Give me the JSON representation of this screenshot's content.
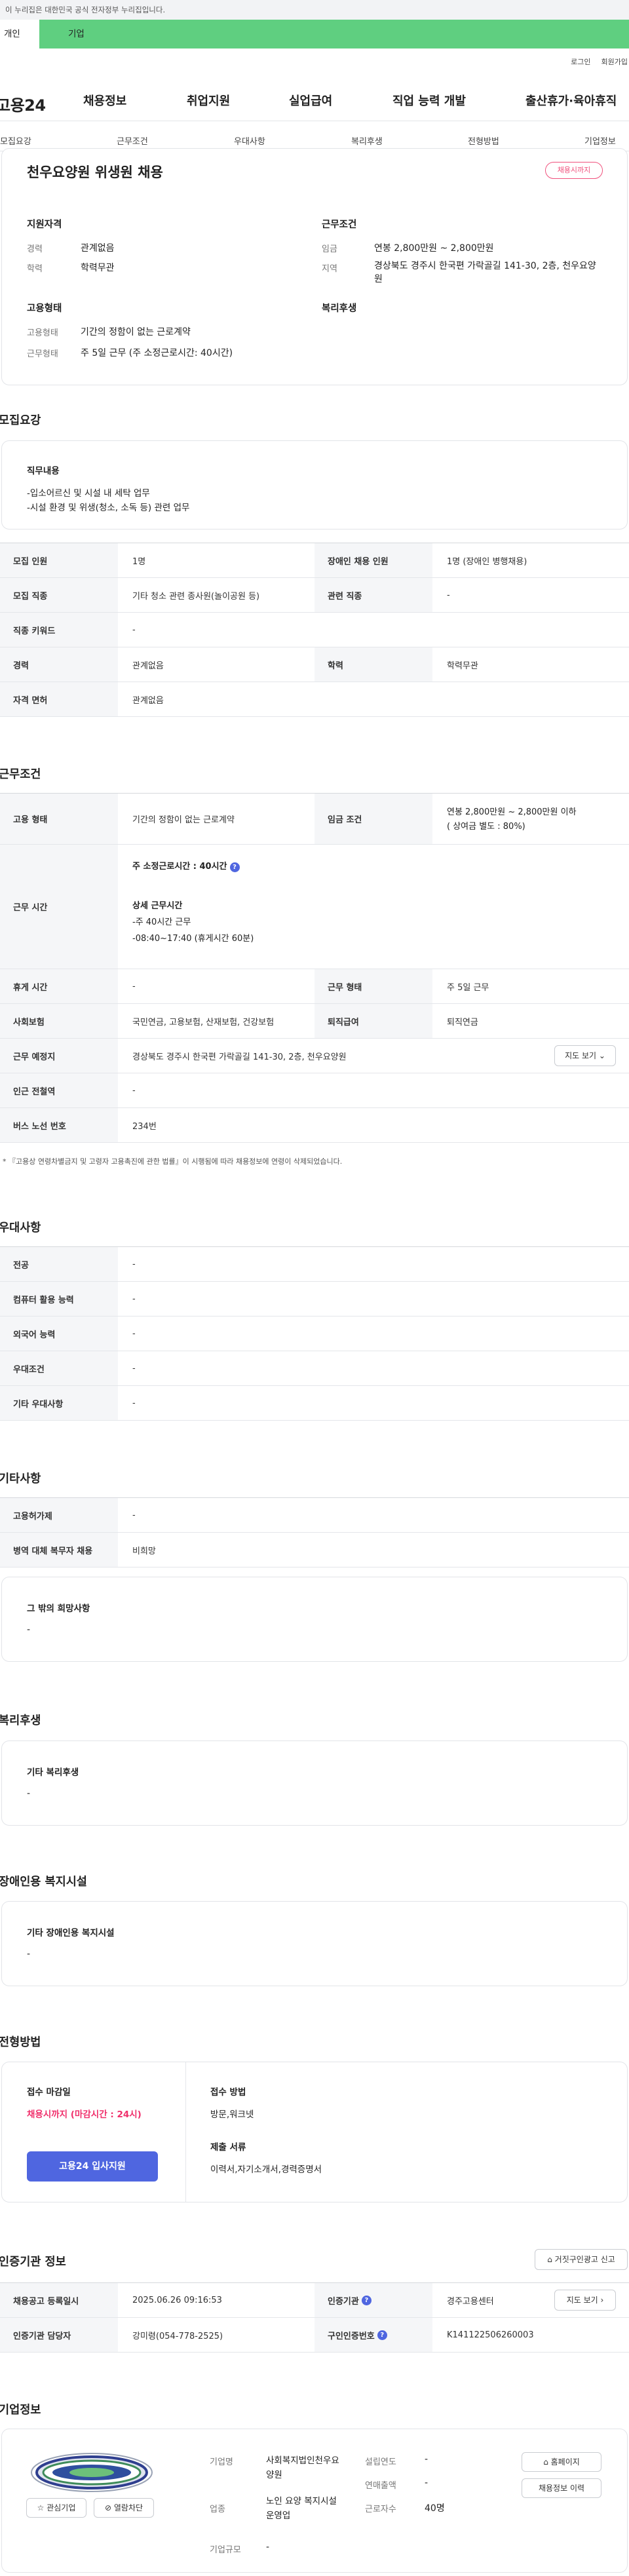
{
  "gov_banner": "이 누리집은 대한민국 공식 전자정부 누리집입니다.",
  "top_tabs": {
    "personal": "개인",
    "company": "기업"
  },
  "util": {
    "login": "로그인",
    "join": "회원가입"
  },
  "brand": "고용24",
  "gnb": [
    "채용정보",
    "취업지원",
    "실업급여",
    "직업 능력 개발",
    "출산휴가·육아휴직"
  ],
  "anchors": [
    "모집요강",
    "근무조건",
    "우대사항",
    "복리후생",
    "전형방법",
    "기업정보"
  ],
  "job": {
    "title": "천우요양원 위생원 채용",
    "badge": "채용시까지",
    "qual_heading": "지원자격",
    "career_label": "경력",
    "career": "관계없음",
    "edu_label": "학력",
    "edu": "학력무관",
    "work_heading": "근무조건",
    "wage_label": "임금",
    "wage": "연봉 2,800만원 ~ 2,800만원",
    "region_label": "지역",
    "region": "경상북도 경주시 한국편 가락골길 141-30, 2층, 천우요양원",
    "emp_heading": "고용형태",
    "emp_type_label": "고용형태",
    "emp_type": "기간의 정함이 없는 근로계약",
    "work_form_label": "근무형태",
    "work_form": "주 5일 근무 (주 소정근로시간: 40시간)",
    "welfare_heading": "복리후생"
  },
  "recruit": {
    "heading": "모집요강",
    "duty_label": "직무내용",
    "duty_lines": [
      "-입소어르신 및 시설 내 세탁 업무",
      "-시설 환경 및 위생(청소, 소독 등) 관련 업무"
    ],
    "rows": [
      {
        "k1": "모집 인원",
        "v1": "1명",
        "k2": "장애인 채용 인원",
        "v2": "1명 (장애인 병행채용)"
      },
      {
        "k1": "모집 직종",
        "v1": "기타 청소 관련 종사원(놀이공원 등)",
        "k2": "관련 직종",
        "v2": "-"
      },
      {
        "k1": "직종 키워드",
        "v1": "-"
      },
      {
        "k1": "경력",
        "v1": "관계없음",
        "k2": "학력",
        "v2": "학력무관"
      },
      {
        "k1": "자격 면허",
        "v1": "관계없음"
      }
    ]
  },
  "conditions": {
    "heading": "근무조건",
    "emp_type_label": "고용 형태",
    "emp_type": "기간의 정함이 없는 근로계약",
    "wage_label": "임금 조건",
    "wage1": "연봉 2,800만원 ~ 2,800만원 이하",
    "wage2": "( 상여금 별도 : 80%)",
    "hours_label": "근무 시간",
    "hours_weekly": "주 소정근로시간 : 40시간",
    "hours_detail_title": "상세 근무시간",
    "hours_detail1": "-주 40시간 근무",
    "hours_detail2": "-08:40~17:40 (휴게시간 60분)",
    "rest_label": "휴게 시간",
    "rest": "-",
    "form_label": "근무 형태",
    "form": "주 5일 근무",
    "insurance_label": "사회보험",
    "insurance": "국민연금, 고용보험, 산재보험, 건강보험",
    "severance_label": "퇴직급여",
    "severance": "퇴직연금",
    "place_label": "근무 예정지",
    "place": "경상북도 경주시 한국편 가락골길 141-30, 2층, 천우요양원",
    "map_btn": "지도 보기",
    "station_label": "인근 전철역",
    "station": "-",
    "bus_label": "버스 노선 번호",
    "bus": "234번",
    "note": "* 『고용상 연령차별금지 및 고령자 고용촉진에 관한 법률』이 시행됨에 따라 채용정보에 연령이 삭제되었습니다."
  },
  "preference": {
    "heading": "우대사항",
    "rows": [
      {
        "k": "전공",
        "v": "-"
      },
      {
        "k": "컴퓨터 활용 능력",
        "v": "-"
      },
      {
        "k": "외국어 능력",
        "v": "-"
      },
      {
        "k": "우대조건",
        "v": "-"
      },
      {
        "k": "기타 우대사항",
        "v": "-"
      }
    ]
  },
  "etc": {
    "heading": "기타사항",
    "rows": [
      {
        "k": "고용허가제",
        "v": "-"
      },
      {
        "k": "병역 대체 복무자 채용",
        "v": "비희망"
      }
    ],
    "wish_title": "그 밖의 희망사항",
    "wish": "-"
  },
  "welfare": {
    "heading": "복리후생",
    "title": "기타 복리후생",
    "value": "-"
  },
  "disabled": {
    "heading": "장애인용 복지시설",
    "title": "기타 장애인용 복지시설",
    "value": "-"
  },
  "selection": {
    "heading": "전형방법",
    "deadline_title": "접수 마감일",
    "deadline": "채용시까지 (마감시간 : 24시)",
    "apply_btn": "고용24 입사지원",
    "method_title": "접수 방법",
    "method": "방문,워크넷",
    "docs_title": "제출 서류",
    "docs": "이력서,자기소개서,경력증명서"
  },
  "agency": {
    "heading": "인증기관 정보",
    "report_btn": "거짓구인광고 신고",
    "reg_label": "채용공고 등록일시",
    "reg": "2025.06.26 09:16:53",
    "cert_label": "인증기관",
    "cert": "경주고용센터",
    "map_btn": "지도 보기",
    "staff_label": "인증기관 담당자",
    "staff": "강미령(054-778-2525)",
    "cert_no_label": "구인인증번호",
    "cert_no": "K141122506260003"
  },
  "company": {
    "heading": "기업정보",
    "fav_btn": "관심기업",
    "block_btn": "열람차단",
    "name_label": "기업명",
    "name": "사회복지법인천우요양원",
    "industry_label": "업종",
    "industry": "노인 요양 복지시설 운영업",
    "size_label": "기업규모",
    "size": "-",
    "founded_label": "설립연도",
    "founded": "-",
    "sales_label": "연매출액",
    "sales": "-",
    "employees_label": "근로자수",
    "employees": "40명",
    "home_btn": "홈페이지",
    "history_btn": "채용정보 이력"
  }
}
